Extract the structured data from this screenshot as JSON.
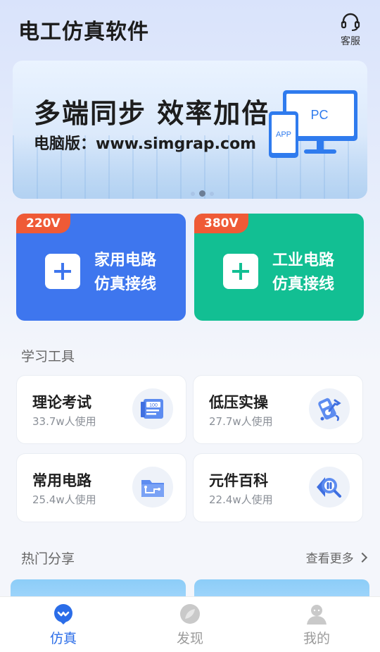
{
  "header": {
    "title": "电工仿真软件",
    "support_label": "客服",
    "support_icon": "headset-icon"
  },
  "banner": {
    "headline": "多端同步 效率加倍",
    "subline": "电脑版：www.simgrap.com",
    "pc_label": "PC",
    "app_label": "APP",
    "slides": 3,
    "active_slide": 1
  },
  "circuits": [
    {
      "voltage": "220V",
      "line1": "家用电路",
      "line2": "仿真接线",
      "color": "#3e76ee"
    },
    {
      "voltage": "380V",
      "line1": "工业电路",
      "line2": "仿真接线",
      "color": "#12bf93"
    }
  ],
  "tools_section": {
    "title": "学习工具"
  },
  "tools": [
    {
      "name": "理论考试",
      "users": "33.7w人使用",
      "icon": "exam-paper-icon",
      "icon_text": "100"
    },
    {
      "name": "低压实操",
      "users": "27.7w人使用",
      "icon": "multimeter-wrench-icon"
    },
    {
      "name": "常用电路",
      "users": "25.4w人使用",
      "icon": "circuit-folder-icon"
    },
    {
      "name": "元件百科",
      "users": "22.4w人使用",
      "icon": "component-search-icon"
    }
  ],
  "hot_section": {
    "title": "热门分享",
    "more_label": "查看更多"
  },
  "nav": [
    {
      "label": "仿真",
      "icon": "simulation-icon",
      "active": true,
      "accent": "#2b6de8"
    },
    {
      "label": "发现",
      "icon": "discover-icon",
      "active": false
    },
    {
      "label": "我的",
      "icon": "profile-icon",
      "active": false
    }
  ]
}
